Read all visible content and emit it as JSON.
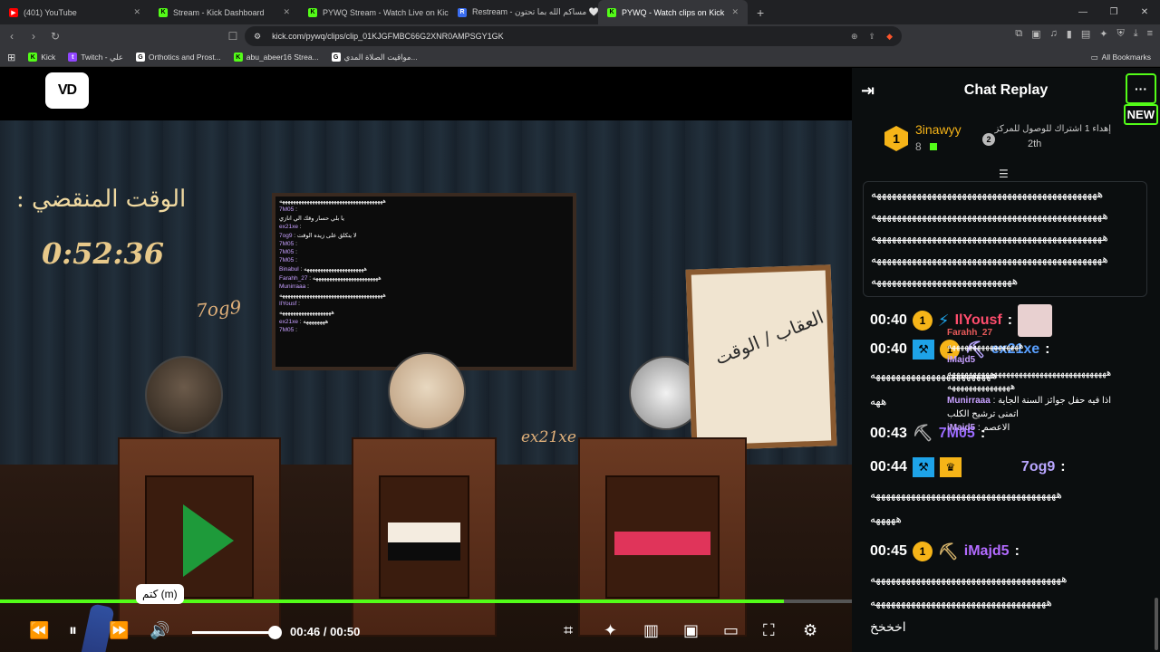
{
  "browser": {
    "tabs": [
      {
        "label": "(401) YouTube",
        "color": "#ff0000",
        "glyph": "▶"
      },
      {
        "label": "Stream - Kick Dashboard",
        "color": "#53fc18",
        "glyph": "K"
      },
      {
        "label": "PYWQ Stream - Watch Live on Kick",
        "color": "#53fc18",
        "glyph": "K"
      },
      {
        "label": "Restream - مساكم الله بما تحتون 🤍",
        "color": "#3a6df0",
        "glyph": "R"
      },
      {
        "label": "PYWQ - Watch clips on Kick",
        "color": "#53fc18",
        "glyph": "K"
      }
    ],
    "url": "kick.com/pywq/clips/clip_01KJGFMBC66G2XNR0AMPSGY1GK",
    "bookmarks": [
      {
        "label": "Kick",
        "color": "#53fc18",
        "glyph": "K"
      },
      {
        "label": "Twitch - علي",
        "color": "#9146ff",
        "glyph": "t"
      },
      {
        "label": "Orthotics and Prost...",
        "color": "#ffffff",
        "glyph": "G"
      },
      {
        "label": "abu_abeer16 Strea...",
        "color": "#53fc18",
        "glyph": "K"
      },
      {
        "label": "مواقيت الصلاة المدي...",
        "color": "#ffffff",
        "glyph": "G"
      }
    ],
    "all_bookmarks": "All Bookmarks"
  },
  "video": {
    "logo_text": "VD",
    "timer_title": "الوقت المنقضي :",
    "timer_value": "0:52:36",
    "label_left": "7og9",
    "label_center": "ex21xe",
    "board_text": "العقاب / الوقت",
    "tv_lines": [
      {
        "user": "",
        "text": "ههههههههههههههههههههههههههههههههههههههه"
      },
      {
        "user": "7M05",
        "text": ""
      },
      {
        "user": "",
        "text": "يا بلي حسار وقك الي انازي"
      },
      {
        "user": "ex21xe",
        "text": ""
      },
      {
        "user": "7og9",
        "text": "لا يتكلق على زيده الوقت"
      },
      {
        "user": "7M05",
        "text": ""
      },
      {
        "user": "7M05",
        "text": ""
      },
      {
        "user": "7M05",
        "text": ""
      },
      {
        "user": "Binabul",
        "text": "ههههههههههههههههههههههه"
      },
      {
        "user": "Farahh_27",
        "text": "ههههههههههههههههههههههههه"
      },
      {
        "user": "Munirraaa",
        "text": ""
      },
      {
        "user": "",
        "text": "ههههههههههههههههههههههههههههههههههههههه"
      },
      {
        "user": "IlYousf",
        "text": ""
      },
      {
        "user": "",
        "text": "هههههههههههههههههههه"
      },
      {
        "user": "ex21xe",
        "text": "ههههههههه"
      },
      {
        "user": "7M05",
        "text": ""
      }
    ],
    "tooltip": "كتم (m)",
    "progress_fraction": 0.92,
    "volume_fraction": 1.0,
    "time_current": "00:46",
    "time_sep": "/",
    "time_total": "00:50"
  },
  "chat": {
    "title": "Chat Replay",
    "new_label": "NEW",
    "pinned": {
      "rank": "1",
      "user": "3inawyy",
      "count": "8",
      "message": "إهداء 1 اشتراك للوصول للمركز",
      "rank2": "2",
      "place": "2th"
    },
    "spam_lines": [
      "هههههههههههههههههههههههههههههههههههههههههههههه",
      "ههههههههههههههههههههههههههههههههههههههههههههههه",
      "ههههههههههههههههههههههههههههههههههههههههههههههه",
      "ههههههههههههههههههههههههههههههههههههههههههههههه",
      "ههههههههههههههههههههههههههههه"
    ],
    "messages": [
      {
        "ts": "00:40",
        "user": "IlYousf",
        "color": "#ff4d6d",
        "text": ""
      },
      {
        "ts": "00:40",
        "user": "ex21xe",
        "color": "#5aa0ff",
        "text": "ههههههههههههههههههههههههه"
      },
      {
        "ts": "00:43",
        "user": "7M05",
        "color": "#9b6bff",
        "text": ""
      },
      {
        "ts": "00:44",
        "user": "7og9",
        "color": "#b9a6ff",
        "text": "هههههههههههههههههههههههههههههههههههههه"
      },
      {
        "ts": "00:45",
        "user": "iMajd5",
        "color": "#b36bff",
        "text": "ههههههههههههههههههههههههههههههههههههههه"
      }
    ],
    "extra_lines": [
      "ههه",
      "هههههه",
      "هههههههههههههههههههههههههههههههههههه",
      "اخخخخ"
    ],
    "overlay_lines": [
      {
        "user": "Farahh_27",
        "text": ""
      },
      {
        "user": "",
        "text": "هههههههههههههههههه"
      },
      {
        "user": "iMajd5",
        "text": ""
      },
      {
        "user": "",
        "text": "ههههههههههههههههههههههههههههههههههههههه"
      },
      {
        "user": "",
        "text": "هههههههههههههههه"
      },
      {
        "user": "Munirraaa",
        "text": "اذا فيه حفل جوائز السنة الجاية"
      },
      {
        "user": "",
        "text": "اتمنى ترشيح الكلب"
      },
      {
        "user": "iMajd5",
        "text": "الاعصم"
      }
    ]
  }
}
